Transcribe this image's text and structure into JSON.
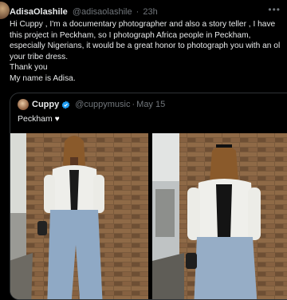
{
  "reply": {
    "author_name": "AdisaOlashile",
    "handle": "@adisaolashile",
    "separator": "·",
    "time": "23h",
    "text": "Hi Cuppy , I'm a documentary photographer and also a story teller , I have\nthis project in Peckham, so I photograph Africa people in Peckham,\nespecially Nigerians, it would be a great honor to photograph you with an ol\nyour tribe dress.\nThank you\nMy name is Adisa.",
    "more_icon": "more-horizontal-icon"
  },
  "quote": {
    "author_name": "Cuppy",
    "handle": "@cuppymusic",
    "separator": "·",
    "date": "May 15",
    "text": "Peckham",
    "verified_color": "#1d9bf0",
    "icons": [
      "avatar",
      "verified-badge-icon",
      "white-heart-icon"
    ]
  },
  "colors": {
    "background": "#000000",
    "text": "#e7e9ea",
    "muted": "#71767b",
    "border": "#2f3336"
  }
}
